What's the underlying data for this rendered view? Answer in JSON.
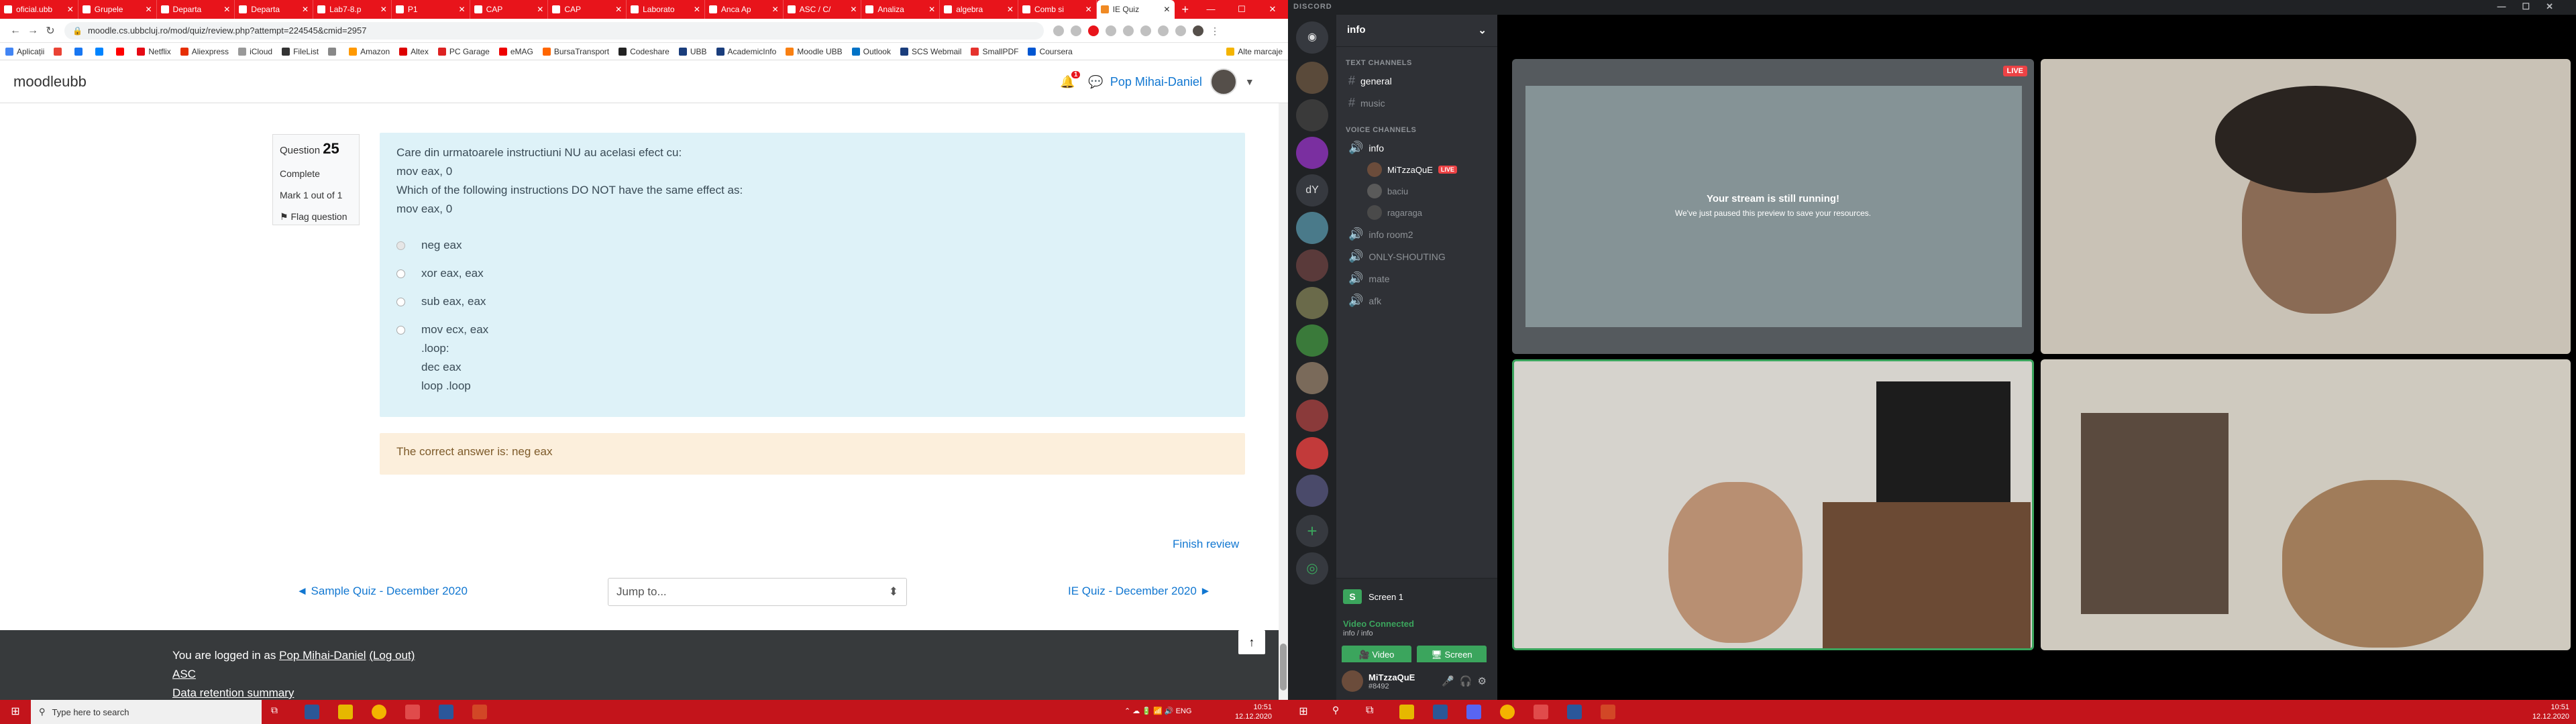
{
  "browser": {
    "tabs": [
      {
        "label": "oficial.ubb"
      },
      {
        "label": "Grupele"
      },
      {
        "label": "Departa"
      },
      {
        "label": "Departa"
      },
      {
        "label": "Lab7-8.p"
      },
      {
        "label": "P1"
      },
      {
        "label": "CAP"
      },
      {
        "label": "CAP"
      },
      {
        "label": "Laborato"
      },
      {
        "label": "Anca Ap"
      },
      {
        "label": "ASC / C/"
      },
      {
        "label": "Analiza"
      },
      {
        "label": "algebra"
      },
      {
        "label": "Comb si"
      },
      {
        "label": "IE Quiz"
      }
    ],
    "url": "moodle.cs.ubbcluj.ro/mod/quiz/review.php?attempt=224545&cmid=2957",
    "bookmarks": [
      "Aplicații",
      "",
      "",
      "",
      "",
      "Netflix",
      "Aliexpress",
      "iCloud",
      "FileList",
      "",
      "Amazon",
      "Altex",
      "PC Garage",
      "eMAG",
      "BursaTransport",
      "Codeshare",
      "UBB",
      "AcademicInfo",
      "Moodle UBB",
      "Outlook",
      "SCS Webmail",
      "SmallPDF",
      "Coursera"
    ],
    "bookmarks_right": "Alte marcaje"
  },
  "moodle": {
    "brand": "moodleubb",
    "notification_count": "1",
    "user_name": "Pop Mihai-Daniel",
    "question": {
      "label": "Question",
      "number": "25",
      "status": "Complete",
      "mark": "Mark 1 out of 1",
      "flag": "Flag question",
      "text_lines": [
        "Care din urmatoarele instructiuni NU au acelasi efect cu:",
        "mov eax, 0",
        "Which of the following instructions DO NOT have the same effect as:",
        "mov eax, 0"
      ],
      "options": [
        {
          "lines": [
            "neg eax"
          ],
          "selected": true
        },
        {
          "lines": [
            "xor eax, eax"
          ],
          "selected": false
        },
        {
          "lines": [
            "sub eax, eax"
          ],
          "selected": false
        },
        {
          "lines": [
            "mov ecx, eax",
            ".loop:",
            "dec eax",
            "loop .loop"
          ],
          "selected": false
        }
      ],
      "feedback": "The correct answer is: neg eax"
    },
    "finish_review": "Finish review",
    "prev_link": "◄ Sample Quiz - December 2020",
    "jump_to": "Jump to...",
    "next_link": "IE Quiz - December 2020 ►",
    "footer": {
      "logged_prefix": "You are logged in as",
      "logged_user": "Pop Mihai-Daniel",
      "logout": "(Log out)",
      "asc": "ASC",
      "retention": "Data retention summary"
    },
    "to_top": "↑"
  },
  "discord": {
    "app_title": "DISCORD",
    "server_name": "info",
    "text_category": "TEXT CHANNELS",
    "text_channels": [
      "general",
      "music"
    ],
    "voice_category": "VOICE CHANNELS",
    "voice_channels": [
      "info",
      "info room2",
      "ONLY-SHOUTING",
      "mate",
      "afk"
    ],
    "voice_users": [
      "MiTzzaQuE",
      "baciu",
      "ragaraga"
    ],
    "live_label": "LIVE",
    "guild_labels": [
      "dY"
    ],
    "screen_label": "Screen 1",
    "voice_connected": "Video Connected",
    "voice_channel_path": "info / info",
    "video_button": "Video",
    "screen_button": "Screen",
    "username": "MiTzzaQuE",
    "user_tag": "#8492",
    "stream_title": "Your stream is still running!",
    "stream_sub": "We've just paused this preview to save your resources."
  },
  "taskbar": {
    "search_placeholder": "Type here to search",
    "lang": "ENG",
    "time_left": "10:51",
    "date_left": "12.12.2020",
    "time_right": "10:51",
    "date_right": "12.12.2020"
  },
  "colors": {
    "chrome_red": "#e8141b",
    "moodle_link": "#1177d1",
    "question_bg": "#def2f8",
    "feedback_bg": "#fcefdc",
    "discord_green": "#3ba55d"
  }
}
